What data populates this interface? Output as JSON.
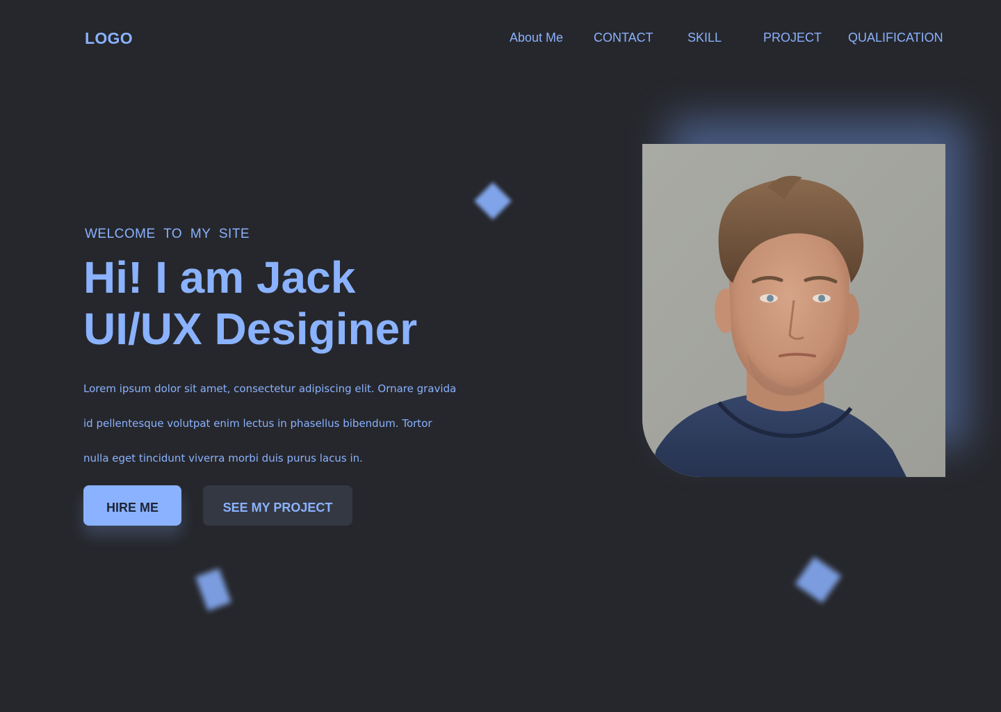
{
  "header": {
    "logo": "LOGO",
    "nav": [
      {
        "label": "About Me"
      },
      {
        "label": "CONTACT"
      },
      {
        "label": "SKILL"
      },
      {
        "label": "PROJECT"
      },
      {
        "label": "QUALIFICATION"
      }
    ]
  },
  "hero": {
    "eyebrow": "WELCOME  TO  MY  SITE",
    "headline_line1": "Hi! I am Jack",
    "headline_line2": "UI/UX Desiginer",
    "description": "Lorem ipsum dolor sit amet, consectetur adipiscing elit. Ornare gravida id pellentesque volutpat enim lectus in phasellus bibendum. Tortor nulla eget tincidunt viverra morbi duis purus lacus in.",
    "primary_button": "HIRE ME",
    "secondary_button": "SEE MY PROJECT",
    "photo_alt": "Portrait of Jack"
  },
  "colors": {
    "background": "#26272c",
    "accent": "#8ab2ff",
    "secondary_button_bg": "#343843",
    "primary_button_text": "#1d2535"
  },
  "icons": {
    "decoration": "blurred-cube-shape"
  }
}
